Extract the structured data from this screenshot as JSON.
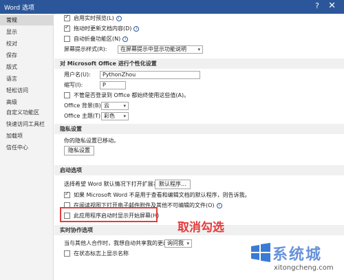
{
  "window": {
    "title": "Word 选项",
    "help": "?",
    "close": "✕"
  },
  "sidebar": {
    "items": [
      {
        "label": "常规",
        "active": true
      },
      {
        "label": "显示"
      },
      {
        "label": "校对"
      },
      {
        "label": "保存"
      },
      {
        "label": "版式"
      },
      {
        "label": "语言"
      },
      {
        "label": "轻松访问"
      },
      {
        "label": "高级"
      },
      {
        "label": "自定义功能区"
      },
      {
        "label": "快速访问工具栏"
      },
      {
        "label": "加载项"
      },
      {
        "label": "信任中心"
      }
    ]
  },
  "ui_options": {
    "realtime_preview": "启用实时预览(L)",
    "live_layout_update": "拖动时更新文档内容(D)",
    "collapse_ribbon": "自动折叠功能区(N)",
    "screentip_label": "屏幕提示样式(R):",
    "screentip_value": "在屏幕提示中显示功能说明"
  },
  "personalize": {
    "heading": "对 Microsoft Office 进行个性化设置",
    "username_label": "用户名(U):",
    "username_value": "PythonZhou",
    "initials_label": "缩写(I):",
    "initials_value": "P",
    "always_use": "不管是否登录到 Office 都始终使用这些值(A)。",
    "background_label": "Office 背景(B):",
    "background_value": "云",
    "theme_label": "Office 主题(T):",
    "theme_value": "彩色"
  },
  "privacy": {
    "heading": "隐私设置",
    "note": "你的隐私设置已移动。",
    "button": "隐私设置"
  },
  "startup": {
    "heading": "启动选项",
    "default_ext_label": "选择希望 Word 默认情况下打开扩展名:",
    "default_programs_button": "默认程序...",
    "tell_me": "如果 Microsoft Word 不是用于查看和编辑文档的默认程序，则告诉我。",
    "open_attachments": "在阅读视图下打开电子邮件附件及其他不可编辑的文件(O)",
    "show_start_screen": "此应用程序启动时显示开始屏幕(H)"
  },
  "coauthoring": {
    "heading": "实时协作选项",
    "share_label": "当与其他人合作时，我想自动共享我的更改:",
    "share_value": "询问我",
    "show_names": "在状态标志上显示名称"
  },
  "annotation": {
    "text": "取消勾选",
    "color": "#e53b3b"
  },
  "watermark": {
    "name": "系统城",
    "url": "xitongcheng.com"
  },
  "colors": {
    "titlebar": "#2b579a",
    "highlight": "#e53b3b"
  }
}
